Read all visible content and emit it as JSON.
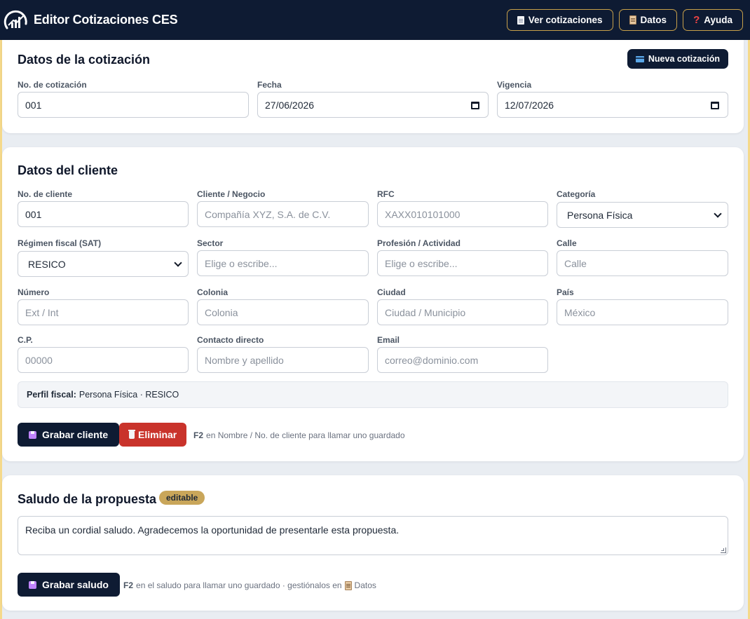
{
  "app": {
    "title": "Editor Cotizaciones CES"
  },
  "topbar": {
    "view_quotes": "Ver cotizaciones",
    "data": "Datos",
    "help": "Ayuda"
  },
  "quote": {
    "title": "Datos de la cotización",
    "new_button": "Nueva cotización",
    "number_label": "No. de cotización",
    "number_value": "001",
    "date_label": "Fecha",
    "date_value": "27/06/2026",
    "validity_label": "Vigencia",
    "validity_value": "12/07/2026"
  },
  "client": {
    "title": "Datos del cliente",
    "client_no_label": "No. de cliente",
    "client_no_value": "001",
    "business_label": "Cliente / Negocio",
    "business_placeholder": "Compañía XYZ, S.A. de C.V.",
    "rfc_label": "RFC",
    "rfc_placeholder": "XAXX010101000",
    "category_label": "Categoría",
    "category_value": "Persona Física",
    "regime_label": "Régimen fiscal (SAT)",
    "regime_value": "RESICO",
    "sector_label": "Sector",
    "sector_placeholder": "Elige o escribe...",
    "profession_label": "Profesión / Actividad",
    "profession_placeholder": "Elige o escribe...",
    "street_label": "Calle",
    "street_placeholder": "Calle",
    "number_label": "Número",
    "number_placeholder": "Ext / Int",
    "colony_label": "Colonia",
    "colony_placeholder": "Colonia",
    "city_label": "Ciudad",
    "city_placeholder": "Ciudad / Municipio",
    "country_label": "País",
    "country_placeholder": "México",
    "zip_label": "C.P.",
    "zip_placeholder": "00000",
    "contact_label": "Contacto directo",
    "contact_placeholder": "Nombre y apellido",
    "email_label": "Email",
    "email_placeholder": "correo@dominio.com",
    "fiscal_profile_label": "Perfil fiscal:",
    "fiscal_profile_value": "Persona Física · RESICO",
    "save_button": "Grabar cliente",
    "delete_button": "Eliminar",
    "hint_key": "F2",
    "hint_text": "en Nombre / No. de cliente para llamar uno guardado"
  },
  "greeting": {
    "title": "Saludo de la propuesta",
    "badge": "editable",
    "text": "Reciba un cordial saludo. Agradecemos la oportunidad de presentarle esta propuesta.",
    "save_button": "Grabar saludo",
    "hint_key": "F2",
    "hint_text": "en el saludo para llamar uno guardado · gestiónalos en",
    "hint_link": "Datos"
  },
  "colors": {
    "navy": "#0e1b33",
    "gold": "#c9a65a",
    "danger": "#c9332b",
    "page_bg": "#e9edf2"
  }
}
